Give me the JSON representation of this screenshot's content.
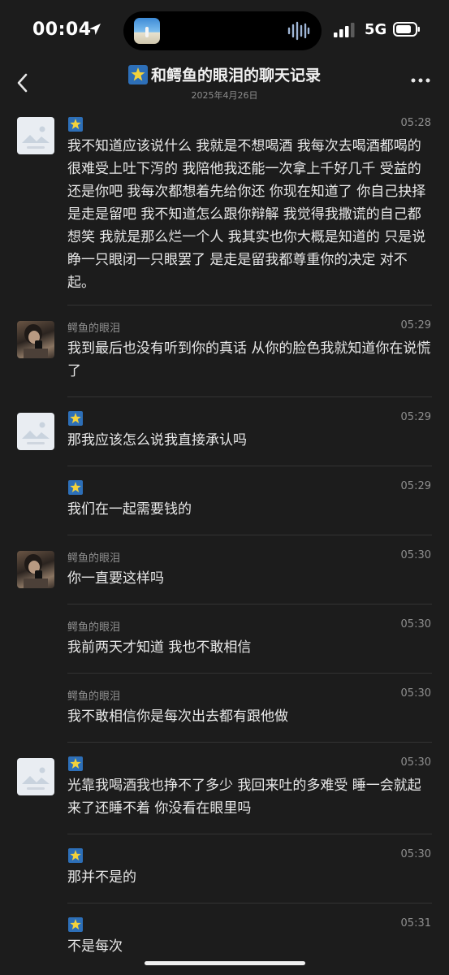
{
  "status": {
    "time": "00:04",
    "network": "5G"
  },
  "nav": {
    "title": "和鳄鱼的眼泪的聊天记录",
    "date": "2025年4月26日"
  },
  "messages": [
    {
      "sender": "",
      "time": "05:28",
      "text": "我不知道应该说什么 我就是不想喝酒 我每次去喝酒都喝的很难受上吐下泻的 我陪他我还能一次拿上千好几千 受益的还是你吧 我每次都想着先给你还 你现在知道了 你自己抉择是走是留吧 我不知道怎么跟你辩解 我觉得我撒谎的自己都想笑 我就是那么烂一个人 我其实也你大概是知道的 只是说睁一只眼闭一只眼罢了 是走是留我都尊重你的决定 对不起。"
    },
    {
      "sender": "鳄鱼的眼泪",
      "time": "05:29",
      "text": "我到最后也没有听到你的真话 从你的脸色我就知道你在说慌了"
    },
    {
      "sender": "",
      "time": "05:29",
      "text": "那我应该怎么说我直接承认吗"
    },
    {
      "sender": "",
      "time": "05:29",
      "text": "我们在一起需要钱的"
    },
    {
      "sender": "鳄鱼的眼泪",
      "time": "05:30",
      "text": "你一直要这样吗"
    },
    {
      "sender": "鳄鱼的眼泪",
      "time": "05:30",
      "text": "我前两天才知道 我也不敢相信"
    },
    {
      "sender": "鳄鱼的眼泪",
      "time": "05:30",
      "text": "我不敢相信你是每次出去都有跟他做"
    },
    {
      "sender": "",
      "time": "05:30",
      "text": "光靠我喝酒我也挣不了多少 我回来吐的多难受 睡一会就起来了还睡不着 你没看在眼里吗"
    },
    {
      "sender": "",
      "time": "05:30",
      "text": "那并不是的"
    },
    {
      "sender": "",
      "time": "05:31",
      "text": "不是每次"
    }
  ]
}
